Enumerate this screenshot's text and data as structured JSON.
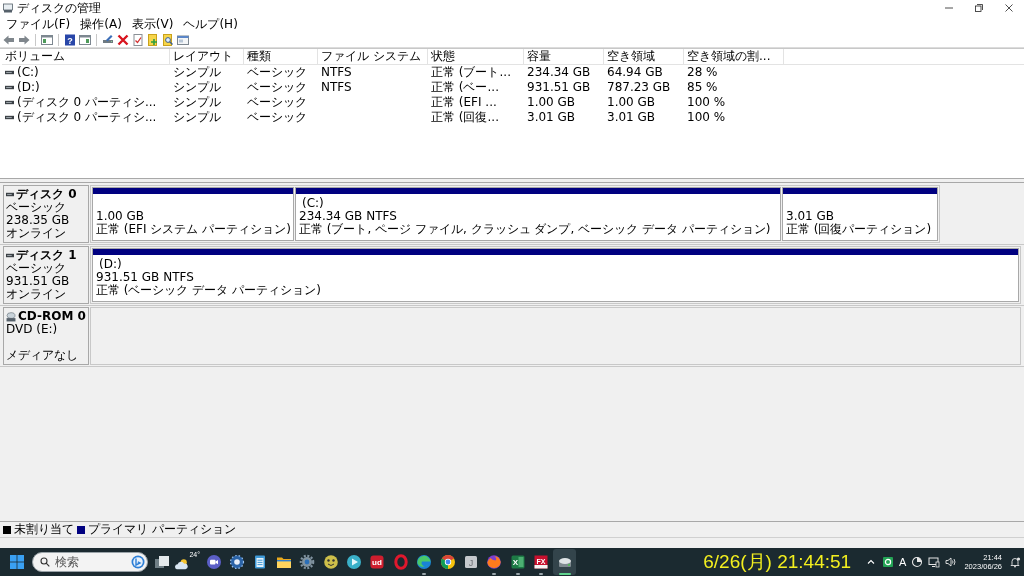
{
  "window": {
    "title": "ディスクの管理"
  },
  "menu": [
    "ファイル(F)",
    "操作(A)",
    "表示(V)",
    "ヘルプ(H)"
  ],
  "toolbar": [
    {
      "kind": "back"
    },
    {
      "kind": "forward"
    },
    {
      "kind": "separator"
    },
    {
      "kind": "tree"
    },
    {
      "kind": "separator"
    },
    {
      "kind": "help",
      "label": "?"
    },
    {
      "kind": "panel"
    },
    {
      "kind": "separator"
    },
    {
      "kind": "connect"
    },
    {
      "kind": "delete"
    },
    {
      "kind": "checklist"
    },
    {
      "kind": "new"
    },
    {
      "kind": "find"
    },
    {
      "kind": "window"
    }
  ],
  "volumes": {
    "columns": [
      "ボリューム",
      "レイアウト",
      "種類",
      "ファイル システム",
      "状態",
      "容量",
      "空き領域",
      "空き領域の割..."
    ],
    "rows": [
      {
        "volume": "(C:)",
        "layout": "シンプル",
        "type": "ベーシック",
        "file_system": "NTFS",
        "status": "正常 (ブート...",
        "capacity": "234.34 GB",
        "free_space": "64.94 GB",
        "free_percent": "28 %"
      },
      {
        "volume": "(D:)",
        "layout": "シンプル",
        "type": "ベーシック",
        "file_system": "NTFS",
        "status": "正常 (ベー...",
        "capacity": "931.51 GB",
        "free_space": "787.23 GB",
        "free_percent": "85 %"
      },
      {
        "volume": "(ディスク 0 パーティシ...",
        "layout": "シンプル",
        "type": "ベーシック",
        "status": "正常 (EFI ...",
        "capacity": "1.00 GB",
        "free_space": "1.00 GB",
        "free_percent": "100 %"
      },
      {
        "volume": "(ディスク 0 パーティシ...",
        "layout": "シンプル",
        "type": "ベーシック",
        "status": "正常 (回復...",
        "capacity": "3.01 GB",
        "free_space": "3.01 GB",
        "free_percent": "100 %"
      }
    ]
  },
  "disks": [
    {
      "kind": "disk",
      "name": "ディスク 0",
      "type": "ベーシック",
      "capacity": "238.35 GB",
      "status": "オンライン",
      "partitions": [
        {
          "kind": "primary",
          "size": "1.00 GB",
          "status": "正常 (EFI システム パーティション)"
        },
        {
          "kind": "primary",
          "label": "(C:)",
          "size": "234.34 GB NTFS",
          "status": "正常 (ブート, ページ ファイル, クラッシュ ダンプ, ベーシック データ パーティション)"
        },
        {
          "kind": "primary",
          "size": "3.01 GB",
          "status": "正常 (回復パーティション)"
        }
      ]
    },
    {
      "kind": "disk",
      "name": "ディスク 1",
      "type": "ベーシック",
      "capacity": "931.51 GB",
      "status": "オンライン",
      "partitions": [
        {
          "kind": "primary",
          "label": "(D:)",
          "size": "931.51 GB NTFS",
          "status": "正常 (ベーシック データ パーティション)"
        }
      ]
    },
    {
      "kind": "cdrom",
      "name": "CD-ROM 0",
      "type": "DVD (E:)",
      "status": "メディアなし"
    }
  ],
  "legend": [
    {
      "label": "未割り当て",
      "color": "#000000"
    },
    {
      "label": "プライマリ パーティション",
      "color": "#000080"
    }
  ],
  "taskbar": {
    "search": {
      "placeholder": "検索"
    },
    "apps": [
      {
        "kind": "squares",
        "running": false,
        "selected": false
      },
      {
        "kind": "weather",
        "label": "24°",
        "running": false,
        "selected": false
      },
      {
        "kind": "camera",
        "running": false,
        "selected": false
      },
      {
        "kind": "burst",
        "running": false,
        "selected": false
      },
      {
        "kind": "notepad",
        "running": false,
        "selected": false
      },
      {
        "kind": "folder",
        "running": false,
        "selected": false
      },
      {
        "kind": "gear",
        "running": false,
        "selected": false
      },
      {
        "kind": "face",
        "running": false,
        "selected": false
      },
      {
        "kind": "play",
        "running": false,
        "selected": false
      },
      {
        "kind": "ud",
        "label": "ud",
        "running": false,
        "selected": false
      },
      {
        "kind": "ring",
        "running": false,
        "selected": false
      },
      {
        "kind": "swirl",
        "running": true,
        "selected": false
      },
      {
        "kind": "wheel",
        "running": false,
        "selected": false
      },
      {
        "kind": "tile",
        "label": "J",
        "running": false,
        "selected": false
      },
      {
        "kind": "fox",
        "running": true,
        "selected": false
      },
      {
        "kind": "sheet",
        "label": "X",
        "running": true,
        "selected": false
      },
      {
        "kind": "fx",
        "label": "FX",
        "running": true,
        "selected": false
      },
      {
        "kind": "drive",
        "running": true,
        "selected": true
      }
    ],
    "clock_overlay": "6/26(月) 21:44:51",
    "tray": {
      "ime": "A",
      "time": "21:44",
      "date": "2023/06/26"
    }
  }
}
